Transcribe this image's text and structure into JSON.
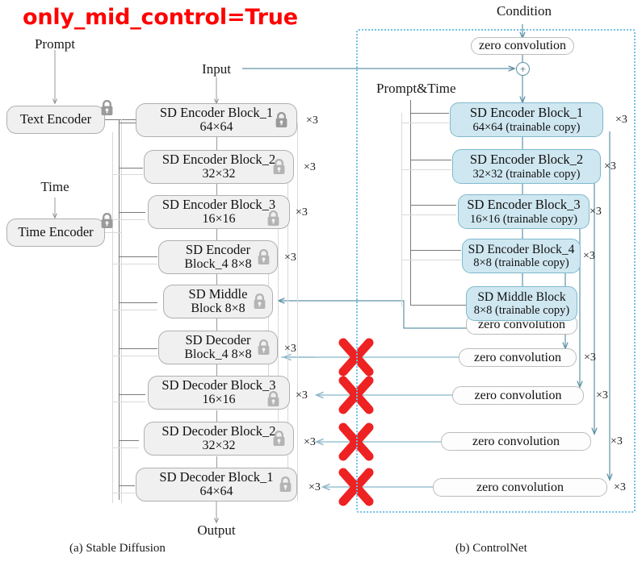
{
  "title": "only_mid_control=True",
  "colors": {
    "title_red": "#ff0000",
    "x_mark_red": "#ee2222",
    "trainable_fill": "#cfe7f0",
    "trainable_border": "#7fb9ce",
    "locked_fill": "#f0f0f0",
    "locked_border": "#b0b0b0",
    "dashed_border": "#6ec1e4",
    "teal_line": "#5f93a8"
  },
  "sd_panel": {
    "caption": "(a) Stable Diffusion",
    "inputs": {
      "prompt": "Prompt",
      "input": "Input",
      "time": "Time",
      "output": "Output"
    },
    "encoders_side": [
      {
        "label": "Text Encoder",
        "locked": true
      },
      {
        "label": "Time Encoder",
        "locked": true
      }
    ],
    "blocks": [
      {
        "line1": "SD Encoder Block_1",
        "line2": "64×64",
        "mult": "×3",
        "locked": true
      },
      {
        "line1": "SD Encoder Block_2",
        "line2": "32×32",
        "mult": "×3",
        "locked": true
      },
      {
        "line1": "SD Encoder Block_3",
        "line2": "16×16",
        "mult": "×3",
        "locked": true
      },
      {
        "line1": "SD Encoder",
        "line2": "Block_4 8×8",
        "mult": "×3",
        "locked": true
      },
      {
        "line1": "SD Middle",
        "line2": "Block 8×8",
        "mult": "",
        "locked": true
      },
      {
        "line1": "SD Decoder",
        "line2": "Block_4 8×8",
        "mult": "×3",
        "locked": true
      },
      {
        "line1": "SD Decoder Block_3",
        "line2": "16×16",
        "mult": "×3",
        "locked": true
      },
      {
        "line1": "SD Decoder Block_2",
        "line2": "32×32",
        "mult": "×3",
        "locked": true
      },
      {
        "line1": "SD Decoder Block_1",
        "line2": "64×64",
        "mult": "×3",
        "locked": true
      }
    ]
  },
  "controlnet_panel": {
    "caption": "(b) ControlNet",
    "inputs": {
      "condition": "Condition",
      "prompt_time": "Prompt&Time"
    },
    "top_zero_conv": "zero convolution",
    "plus": "+",
    "blocks": [
      {
        "line1": "SD Encoder Block_1",
        "line2": "64×64 (trainable copy)",
        "mult": "×3"
      },
      {
        "line1": "SD Encoder Block_2",
        "line2": "32×32 (trainable copy)",
        "mult": "×3"
      },
      {
        "line1": "SD Encoder Block_3",
        "line2": "16×16 (trainable copy)",
        "mult": "×3"
      },
      {
        "line1": "SD Encoder Block_4",
        "line2": "8×8 (trainable copy)",
        "mult": "×3"
      },
      {
        "line1": "SD Middle Block",
        "line2": "8×8 (trainable copy)",
        "mult": ""
      }
    ],
    "zero_convolutions": [
      {
        "label": "zero convolution",
        "mult": ""
      },
      {
        "label": "zero convolution",
        "mult": "×3"
      },
      {
        "label": "zero convolution",
        "mult": "×3"
      },
      {
        "label": "zero convolution",
        "mult": "×3"
      },
      {
        "label": "zero convolution",
        "mult": "×3"
      }
    ]
  },
  "disabled_markers": [
    {
      "name": "x-mark-decoder-4"
    },
    {
      "name": "x-mark-decoder-3"
    },
    {
      "name": "x-mark-decoder-2"
    },
    {
      "name": "x-mark-decoder-1"
    }
  ]
}
